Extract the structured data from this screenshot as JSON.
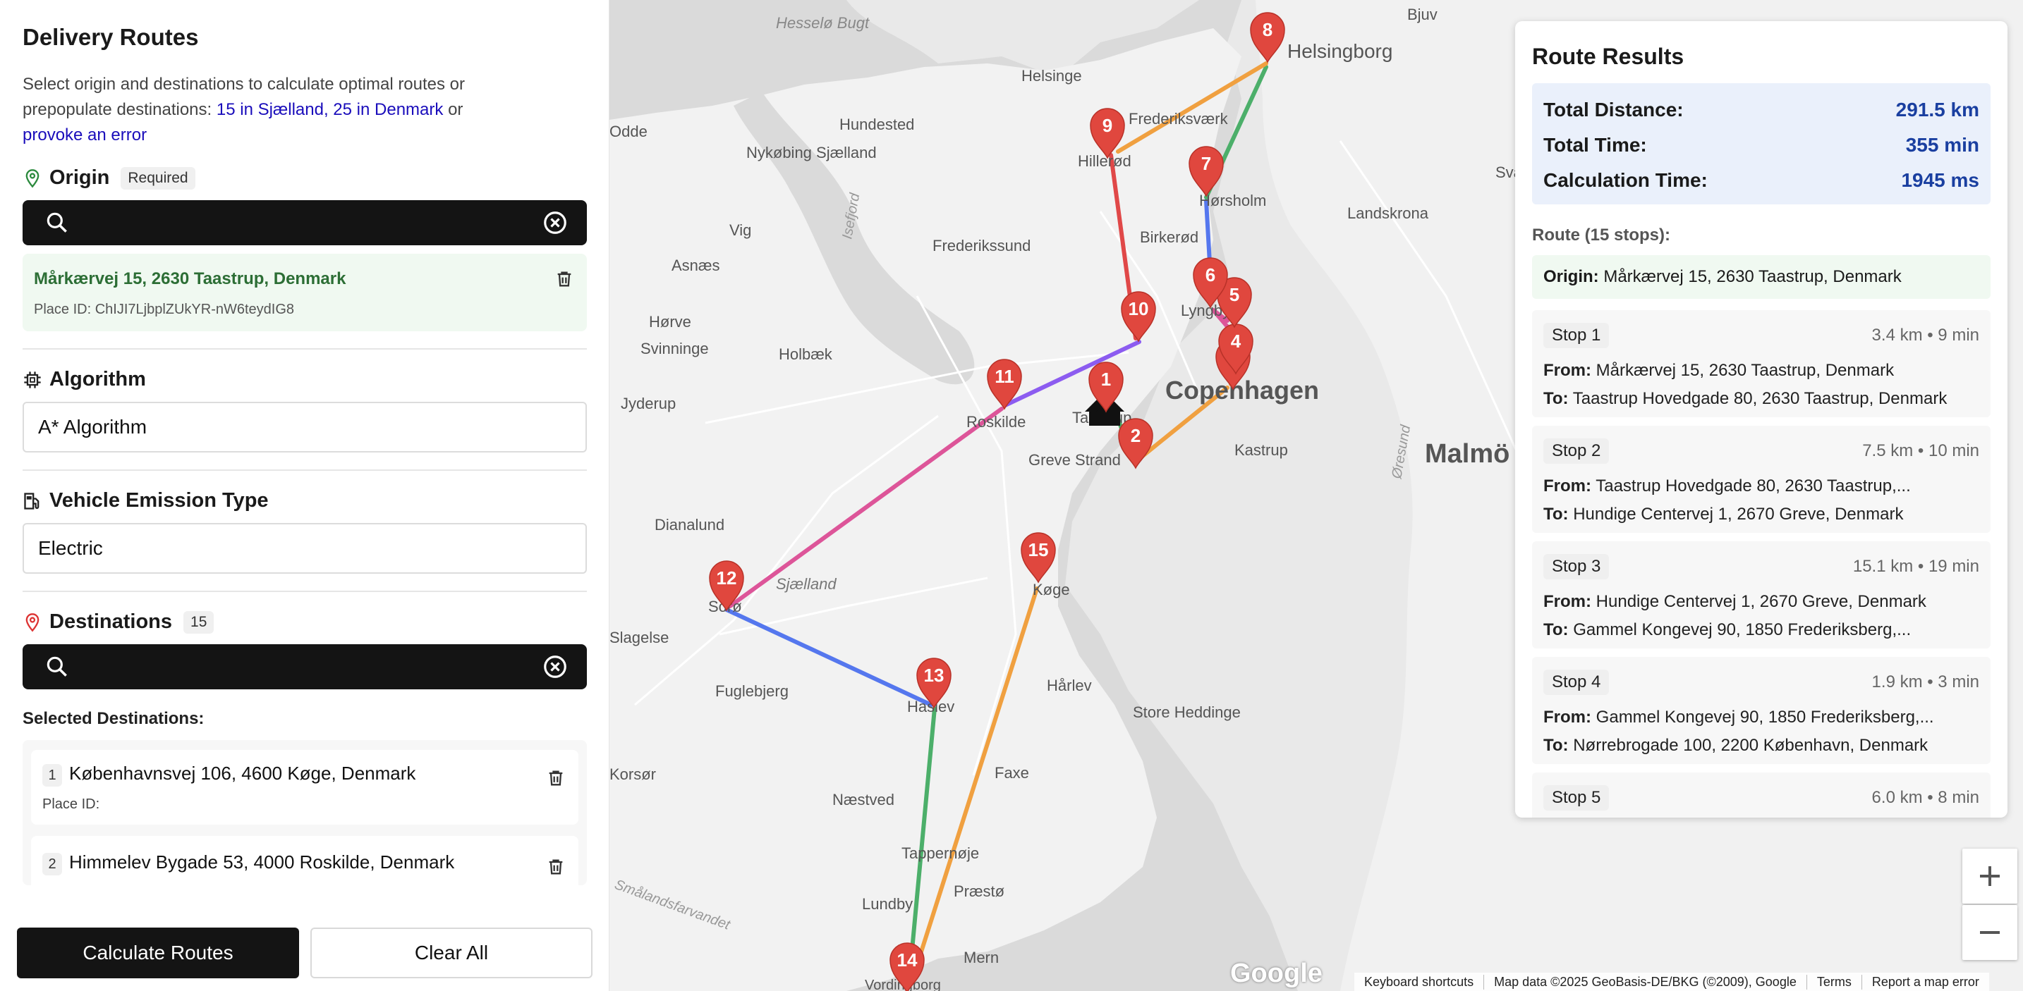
{
  "sidebar": {
    "title": "Delivery Routes",
    "intro_text": "Select origin and destinations to calculate optimal routes or prepopulate destinations:",
    "link_sjaelland": "15 in Sjælland, 25 in Denmark",
    "or_text": "or",
    "link_error": "provoke an error",
    "origin": {
      "label": "Origin",
      "badge": "Required",
      "search_value": "",
      "selected_address": "Mårkærvej 15, 2630 Taastrup, Denmark",
      "selected_place_id": "Place ID: ChIJI7LjbplZUkYR-nW6teydIG8"
    },
    "algorithm": {
      "label": "Algorithm",
      "value": "A* Algorithm"
    },
    "vehicle": {
      "label": "Vehicle Emission Type",
      "value": "Electric"
    },
    "destinations": {
      "label": "Destinations",
      "count": "15",
      "search_value": "",
      "selected_label": "Selected Destinations:",
      "items": [
        {
          "num": "1",
          "address": "Københavnsvej 106, 4600 Køge, Denmark",
          "place_id": "Place ID:"
        },
        {
          "num": "2",
          "address": "Himmelev Bygade 53, 4000 Roskilde, Denmark",
          "place_id": "Place ID:"
        }
      ]
    },
    "buttons": {
      "calculate": "Calculate Routes",
      "clear": "Clear All"
    }
  },
  "results": {
    "title": "Route Results",
    "summary": [
      {
        "label": "Total Distance:",
        "value": "291.5 km"
      },
      {
        "label": "Total Time:",
        "value": "355 min"
      },
      {
        "label": "Calculation Time:",
        "value": "1945 ms"
      }
    ],
    "route_count": "Route (15 stops):",
    "origin_label": "Origin:",
    "origin_value": "Mårkærvej 15, 2630 Taastrup, Denmark",
    "from_label": "From:",
    "to_label": "To:",
    "stops": [
      {
        "name": "Stop 1",
        "meta": "3.4 km • 9 min",
        "from": "Mårkærvej 15, 2630 Taastrup, Denmark",
        "to": "Taastrup Hovedgade 80, 2630 Taastrup, Denmark"
      },
      {
        "name": "Stop 2",
        "meta": "7.5 km • 10 min",
        "from": "Taastrup Hovedgade 80, 2630 Taastrup,...",
        "to": "Hundige Centervej 1, 2670 Greve, Denmark"
      },
      {
        "name": "Stop 3",
        "meta": "15.1 km • 19 min",
        "from": "Hundige Centervej 1, 2670 Greve, Denmark",
        "to": "Gammel Kongevej 90, 1850 Frederiksberg,..."
      },
      {
        "name": "Stop 4",
        "meta": "1.9 km • 3 min",
        "from": "Gammel Kongevej 90, 1850 Frederiksberg,...",
        "to": "Nørrebrogade 100, 2200 København, Denmark"
      },
      {
        "name": "Stop 5",
        "meta": "6.0 km • 8 min",
        "from": "",
        "to": ""
      }
    ]
  },
  "map": {
    "places": [
      "Hesselø Bugt",
      "Helsingborg",
      "Bjuv",
      "Helsinge",
      "Hundested",
      "Hillerød",
      "Frederiksværk",
      "Nykøbing Sjælland",
      "Odde",
      "Vig",
      "Isefjord",
      "Frederikssund",
      "Asnæs",
      "Hørsholm",
      "Birkerød",
      "Landskrona",
      "Hørve",
      "Svinninge",
      "Holbæk",
      "Lyngby",
      "Copenhagen",
      "Malmö",
      "Jyderup",
      "Roskilde",
      "Taastrup",
      "Greve Strand",
      "Kastrup",
      "Øresund",
      "Dianalund",
      "Sorø",
      "Sjælland",
      "Køge",
      "Slagelse",
      "Fuglebjerg",
      "Haslev",
      "Hårlev",
      "Store Heddinge",
      "Faxe",
      "Næstved",
      "Tappernøje",
      "Præstø",
      "Lundby",
      "Mern",
      "Vordingborg",
      "Smålandsfarvandet",
      "Korsør",
      "Sva"
    ],
    "markers": [
      "1",
      "2",
      "3",
      "4",
      "5",
      "6",
      "7",
      "8",
      "9",
      "10",
      "11",
      "12",
      "13",
      "14",
      "15"
    ],
    "route_colors": [
      "#4caf6a",
      "#f0a040",
      "#e04848",
      "#5577ee",
      "#8c5cf0",
      "#dd5599"
    ],
    "google_logo": "Google",
    "footer": [
      "Keyboard shortcuts",
      "Map data ©2025 GeoBasis-DE/BKG (©2009), Google",
      "Terms",
      "Report a map error"
    ],
    "zoom_in": "+",
    "zoom_out": "−"
  }
}
